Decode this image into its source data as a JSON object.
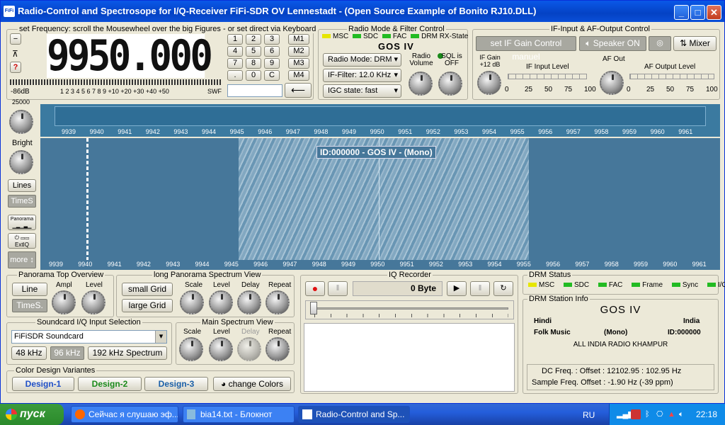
{
  "window": {
    "title": "Radio-Control and Spectrosope for I/Q-Receiver FiFi-SDR OV Lennestadt - (Open Source Example of Bonito RJ10.DLL)",
    "app_icon": "FiFi"
  },
  "freq": {
    "group_label": "set Frequency: scroll the Mousewheel over the big Figures - or set direct via Keyboard",
    "display": "9950.000",
    "scale_label": "-86dB",
    "scale_ticks": "1 2 3 4 5 6 7 8 9 +10 +20 +30 +40 +50",
    "swf": "SWF",
    "keys": [
      "1",
      "2",
      "3",
      "M1",
      "4",
      "5",
      "6",
      "M2",
      "7",
      "8",
      "9",
      "M3",
      ".",
      "0",
      "C",
      "M4"
    ],
    "input": "",
    "btn_q": "?"
  },
  "mode": {
    "group_label": "Radio Mode & Filter Control",
    "leds": [
      "MSC",
      "SDC",
      "FAC",
      "DRM RX-State"
    ],
    "station": "GOS IV",
    "radio_mode": "Radio Mode: DRM",
    "if_filter": "IF-Filter: 12.0 KHz",
    "igc": "IGC state: fast",
    "volume_label": "Radio Volume",
    "sql_label": "SQL is OFF"
  },
  "ifaf": {
    "group_label": "IF-Input & AF-Output Control",
    "gain_btn": "set IF Gain Control manuel",
    "speaker_btn": "Speaker ON",
    "mixer_btn": "Mixer",
    "if_gain": "IF Gain +12 dB",
    "af_out": "AF Out",
    "if_level": "IF Input Level",
    "af_level": "AF Output Level",
    "ticks": [
      "0",
      "25",
      "50",
      "75",
      "100"
    ]
  },
  "left": {
    "top_label": "25000",
    "bright": "Bright",
    "lines": "Lines",
    "times": "TimeS",
    "panorama": "Panorama",
    "extiq": "ExtIQ",
    "more": "more"
  },
  "spectrum": {
    "ticks": [
      "9939",
      "9940",
      "9941",
      "9942",
      "9943",
      "9944",
      "9945",
      "9946",
      "9947",
      "9948",
      "9949",
      "9950",
      "9951",
      "9952",
      "9953",
      "9954",
      "9955",
      "9956",
      "9957",
      "9958",
      "9959",
      "9960",
      "9961"
    ],
    "station_id": "ID:000000 - GOS IV - (Mono)"
  },
  "pano_top": {
    "group_label": "Panorama Top Overview",
    "line": "Line",
    "times": "TimeS.",
    "ampl": "Ampl",
    "level": "Level"
  },
  "long_pano": {
    "group_label": "long Panorama Spectrum View",
    "small": "small Grid",
    "large": "large Grid",
    "scale": "Scale",
    "level": "Level",
    "delay": "Delay",
    "repeat": "Repeat"
  },
  "soundcard": {
    "group_label": "Soundcard I/Q Input Selection",
    "device": "FiFiSDR Soundcard",
    "r48": "48 kHz",
    "r96": "96 kHz",
    "r192": "192 kHz Spectrum"
  },
  "main_spec": {
    "group_label": "Main Spectrum View",
    "scale": "Scale",
    "level": "Level",
    "delay": "Delay",
    "repeat": "Repeat"
  },
  "colors": {
    "group_label": "Color Design Variantes",
    "d1": "Design-1",
    "d2": "Design-2",
    "d3": "Design-3",
    "change": "change Colors"
  },
  "iq": {
    "group_label": "IQ Recorder",
    "bytes": "0 Byte"
  },
  "drm_status": {
    "group_label": "DRM Status",
    "items": [
      "MSC",
      "SDC",
      "FAC",
      "Frame",
      "Sync",
      "I/O"
    ]
  },
  "drm_info": {
    "group_label": "DRM Station Info",
    "station": "GOS IV",
    "lang": "Hindi",
    "country": "India",
    "genre": "Folk Music",
    "mode": "(Mono)",
    "id": "ID:000000",
    "network": "ALL INDIA RADIO KHAMPUR",
    "dc_freq": "DC Freq. : Offset : 12102.95 : 102.95 Hz",
    "sample_freq": "Sample Freq. Offset : -1.90 Hz (-39 ppm)"
  },
  "taskbar": {
    "start": "пуск",
    "tasks": [
      "Сейчас я слушаю эф...",
      "bia14.txt - Блокнот",
      "Radio-Control and Sp..."
    ],
    "lang": "RU",
    "time": "22:18"
  }
}
